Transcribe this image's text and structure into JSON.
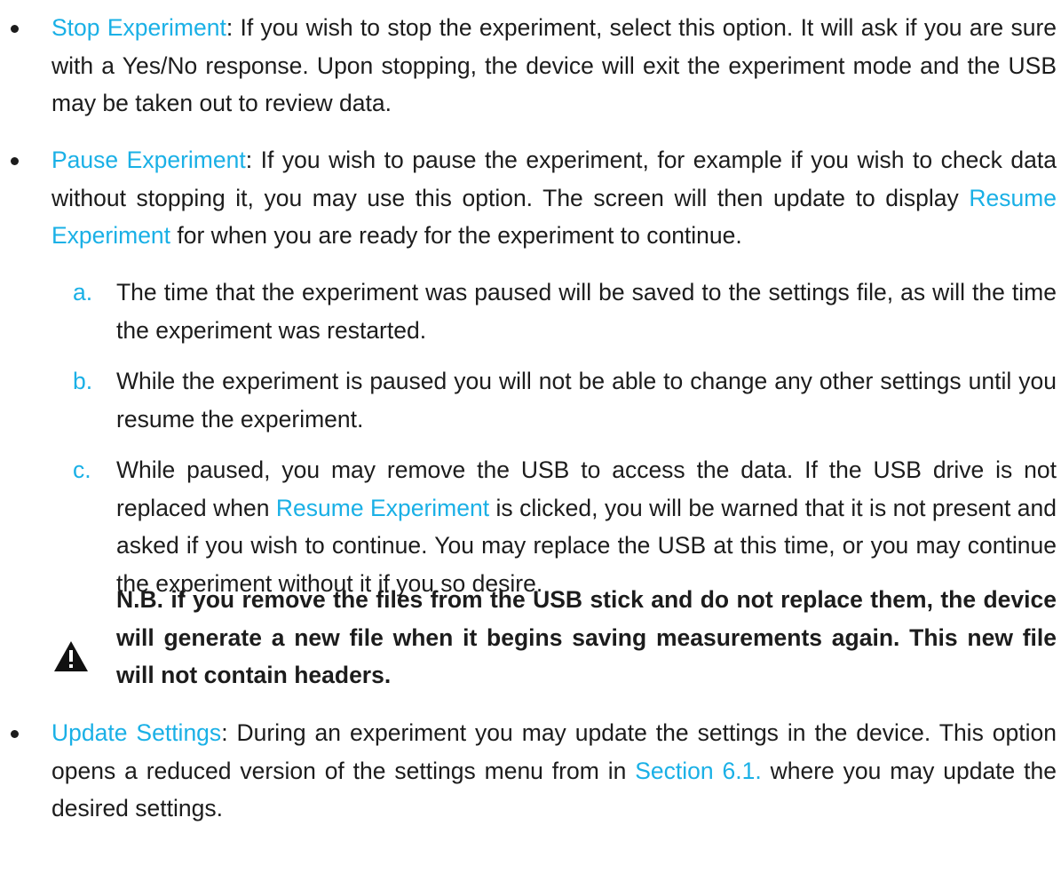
{
  "colors": {
    "accent": "#1ab0e6",
    "text": "#1c1c1c"
  },
  "bullets": [
    {
      "term": "Stop Experiment",
      "text": ": If you wish to stop the experiment, select this option. It will ask if you are sure with a Yes/No response. Upon stopping, the device will exit the experiment mode and the USB may be taken out to review data."
    },
    {
      "term": "Pause Experiment",
      "text_before": ": If you wish to pause the experiment, for example if you wish to check data without stopping it, you may use this option. The screen will then update to display ",
      "link": "Resume Experiment",
      "text_after": " for when you are ready for the experiment to continue."
    },
    {
      "term": "Update Settings",
      "text_before": ": During an experiment you may update the settings in the device. This option opens a reduced version of the settings menu from in ",
      "link": "Section 6.1.",
      "text_after": " where you may update the desired settings."
    }
  ],
  "sub_items": [
    {
      "marker": "a.",
      "text": "The time that the experiment was paused will be saved to the settings file, as will the time the experiment was restarted."
    },
    {
      "marker": "b.",
      "text": "While the experiment is paused you will not be able to change any other settings until you resume the experiment."
    },
    {
      "marker": "c.",
      "text_before": "While paused, you may remove the USB to access the data. If the USB drive is not replaced when ",
      "link": "Resume Experiment",
      "text_after": " is clicked, you will be warned that it is not present and asked if you wish to continue. You may replace the USB at this time, or you may continue the experiment without it if you so desire."
    }
  ],
  "note": {
    "icon": "warning-icon",
    "text": "N.B. if you remove the files from the USB stick and do not replace them, the device will generate a new file when it begins saving measurements again. This new file will not contain headers."
  }
}
